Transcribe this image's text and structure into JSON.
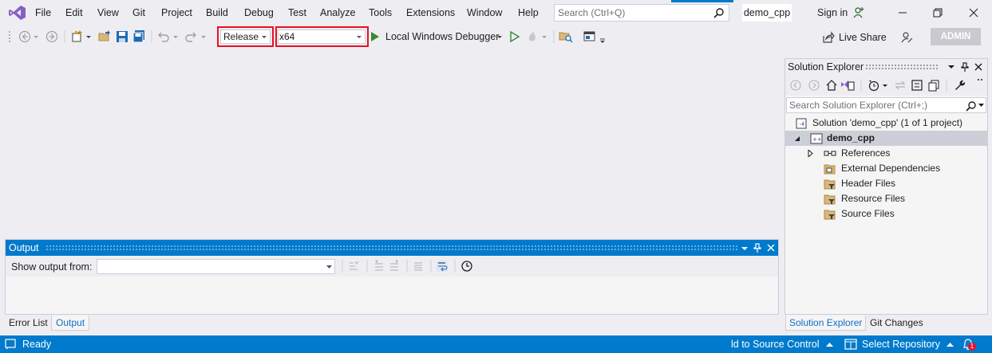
{
  "menu": [
    "File",
    "Edit",
    "View",
    "Git",
    "Project",
    "Build",
    "Debug",
    "Test",
    "Analyze",
    "Tools",
    "Extensions",
    "Window",
    "Help"
  ],
  "search": {
    "placeholder": "Search (Ctrl+Q)"
  },
  "solution_name": "demo_cpp",
  "sign_in": "Sign in",
  "toolbar": {
    "config_value": "Release",
    "platform_value": "x64",
    "debugger_label": "Local Windows Debugger",
    "live_share": "Live Share",
    "admin": "ADMIN"
  },
  "output": {
    "title": "Output",
    "show_from_label": "Show output from:",
    "show_from_value": ""
  },
  "bottom_tabs": [
    "Error List",
    "Output"
  ],
  "solution_explorer": {
    "title": "Solution Explorer",
    "search_placeholder": "Search Solution Explorer (Ctrl+;)",
    "tree": [
      {
        "label": "Solution 'demo_cpp' (1 of 1 project)",
        "icon": "solution-icon"
      },
      {
        "label": "demo_cpp",
        "icon": "cpp-project-icon"
      },
      {
        "label": "References",
        "icon": "references-icon"
      },
      {
        "label": "External Dependencies",
        "icon": "external-deps-icon"
      },
      {
        "label": "Header Files",
        "icon": "filter-folder-icon"
      },
      {
        "label": "Resource Files",
        "icon": "filter-folder-icon"
      },
      {
        "label": "Source Files",
        "icon": "filter-folder-icon"
      }
    ],
    "tabs": [
      "Solution Explorer",
      "Git Changes"
    ]
  },
  "status": {
    "ready": "Ready",
    "source_control": "ld to Source Control",
    "repository": "Select Repository",
    "notifications": "1"
  },
  "colors": {
    "accent": "#007acc",
    "highlight": "#e81123",
    "vs_purple": "#865fc5",
    "play_green": "#388a34"
  }
}
